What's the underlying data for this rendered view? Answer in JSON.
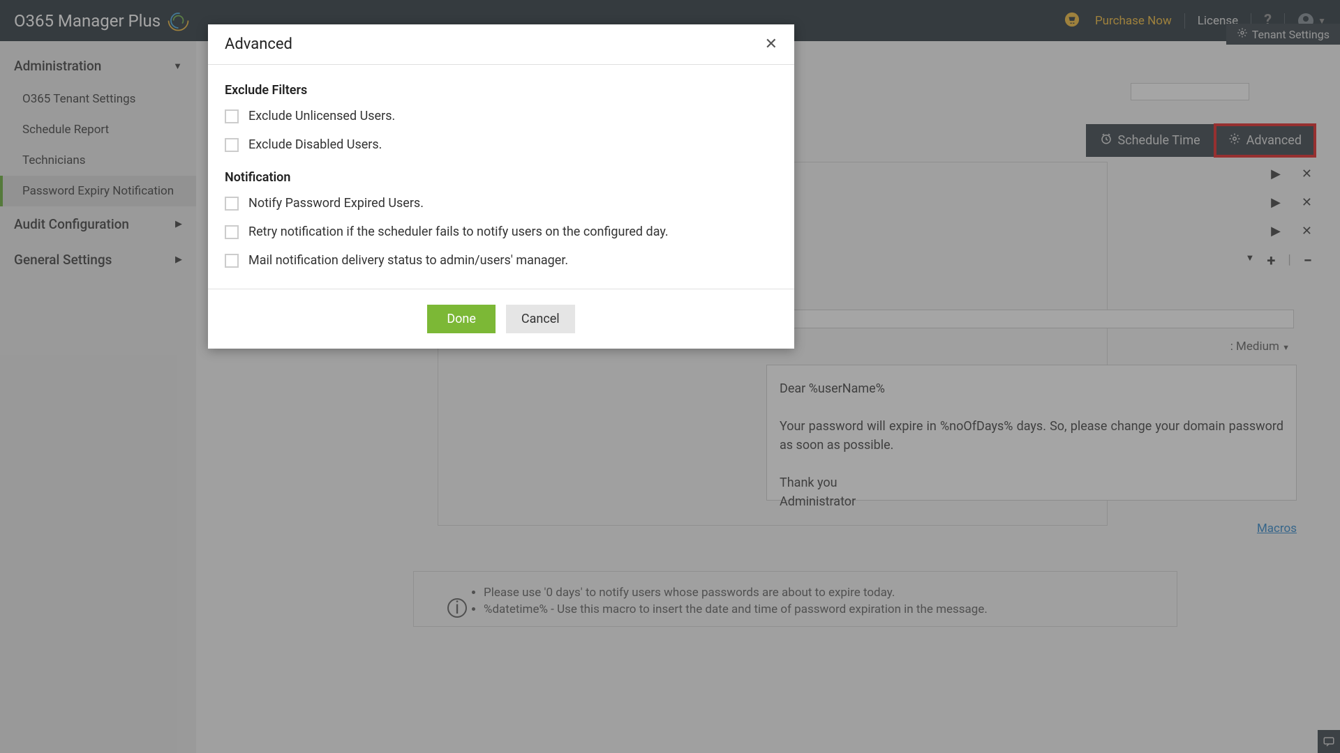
{
  "header": {
    "logo_text": "O365 Manager Plus",
    "purchase_now": "Purchase Now",
    "license": "License",
    "tenant_settings": "Tenant Settings"
  },
  "sidebar": {
    "administration": "Administration",
    "items": {
      "tenant": "O365 Tenant Settings",
      "schedule": "Schedule Report",
      "technicians": "Technicians",
      "password_expiry": "Password Expiry Notification"
    },
    "audit": "Audit Configuration",
    "general": "General Settings"
  },
  "toolbar": {
    "schedule_time": "Schedule Time",
    "advanced": "Advanced"
  },
  "content": {
    "priority_label": ": Medium",
    "email_greeting": "Dear %userName%",
    "email_body": "Your password will expire in %noOfDays% days. So, please change your domain password as soon as possible.",
    "thank_you": "Thank you",
    "admin": "Administrator",
    "macros": "Macros"
  },
  "info": {
    "line1": "Please use '0 days' to notify users whose passwords are about to expire today.",
    "line2": "%datetime% - Use this macro to insert the date and time of password expiration in the message."
  },
  "modal": {
    "title": "Advanced",
    "exclude_filters": "Exclude Filters",
    "exclude_unlicensed": "Exclude Unlicensed Users.",
    "exclude_disabled": "Exclude Disabled Users.",
    "notification": "Notification",
    "notify_expired": "Notify Password Expired Users.",
    "retry": "Retry notification if the scheduler fails to notify users on the configured day.",
    "mail_status": "Mail notification delivery status to admin/users' manager.",
    "done": "Done",
    "cancel": "Cancel"
  }
}
